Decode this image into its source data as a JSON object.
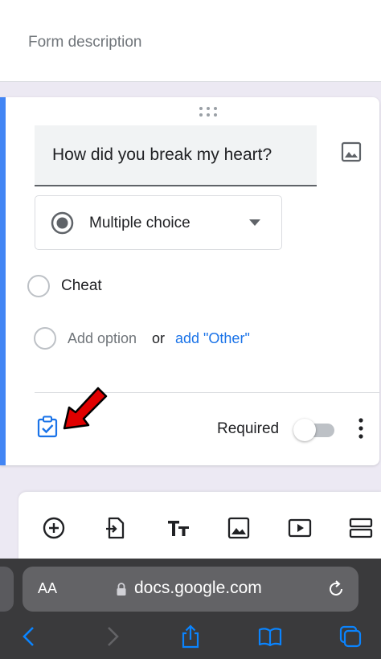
{
  "form": {
    "description_placeholder": "Form description"
  },
  "question": {
    "title": "How did you break my heart?",
    "type_label": "Multiple choice",
    "options": [
      {
        "label": "Cheat"
      }
    ],
    "add_option_label": "Add option",
    "or_label": "or",
    "add_other_label": "add \"Other\"",
    "required_label": "Required",
    "required_on": false
  },
  "toolbar": {
    "tools": [
      "add-question-icon",
      "import-questions-icon",
      "add-title-icon",
      "add-image-icon",
      "add-video-icon",
      "add-section-icon"
    ]
  },
  "browser": {
    "aa_label": "AA",
    "url": "docs.google.com"
  },
  "colors": {
    "accent_blue": "#4285f4",
    "link_blue": "#1a73e8",
    "annotation_red": "#e00000"
  }
}
